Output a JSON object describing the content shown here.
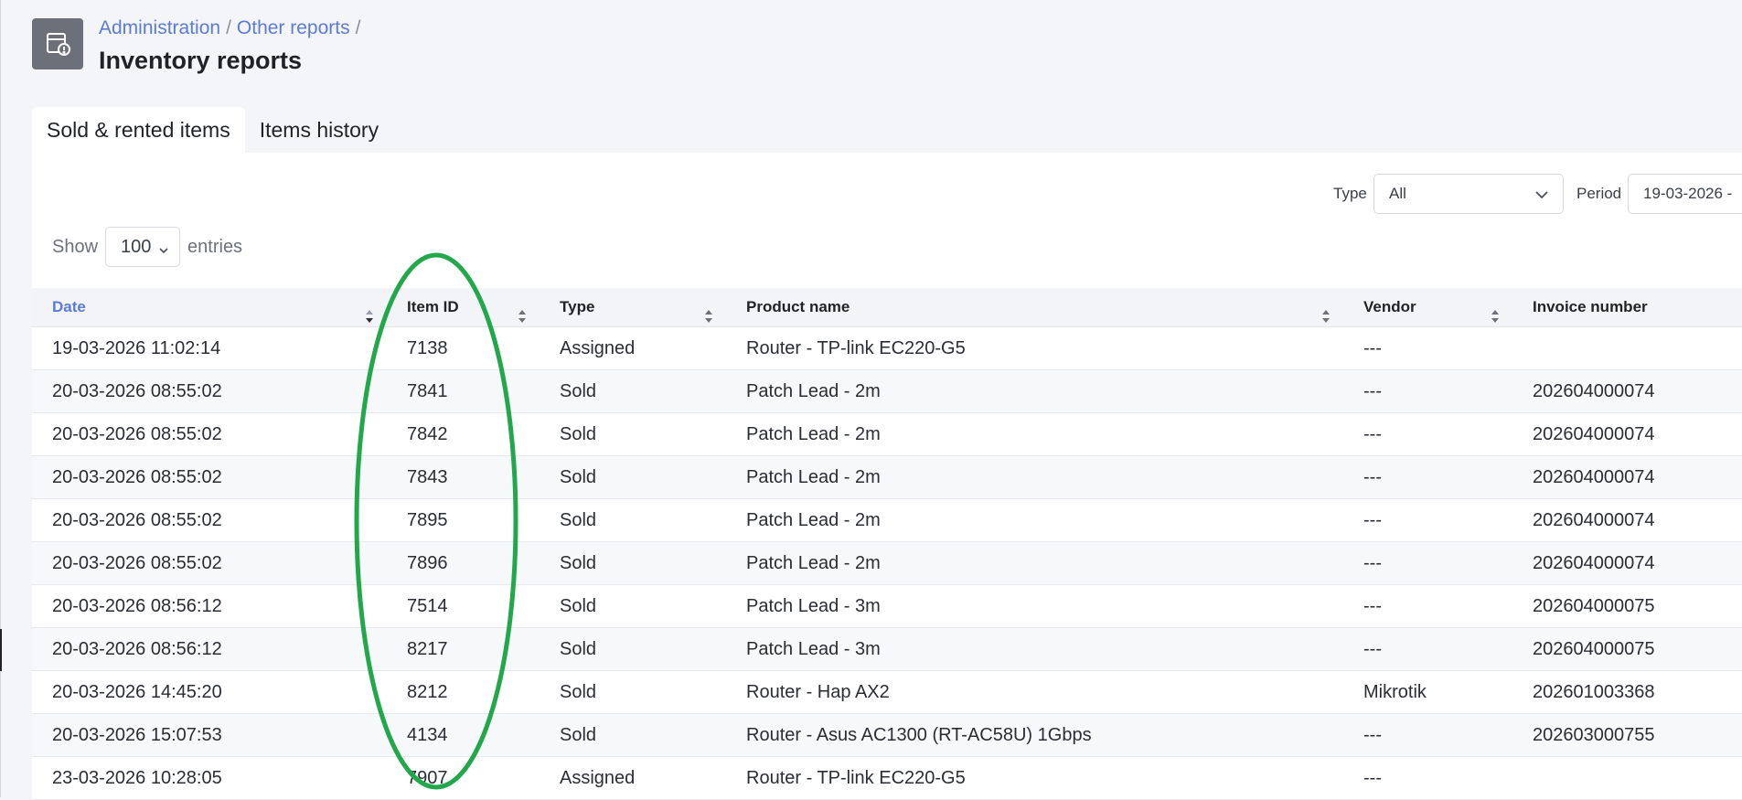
{
  "breadcrumb": {
    "items": [
      "Administration",
      "Other reports"
    ],
    "separator": "/"
  },
  "page_title": "Inventory reports",
  "tabs": [
    {
      "label": "Sold & rented items",
      "active": true
    },
    {
      "label": "Items history",
      "active": false
    }
  ],
  "filters": {
    "type_label": "Type",
    "type_value": "All",
    "period_label": "Period",
    "period_value": "19-03-2026 -"
  },
  "length_menu": {
    "show_label": "Show",
    "value": "100",
    "entries_label": "entries"
  },
  "table": {
    "columns": [
      "Date",
      "Item ID",
      "Type",
      "Product name",
      "Vendor",
      "Invoice number"
    ],
    "rows": [
      [
        "19-03-2026 11:02:14",
        "7138",
        "Assigned",
        "Router - TP-link EC220-G5",
        "---",
        ""
      ],
      [
        "20-03-2026 08:55:02",
        "7841",
        "Sold",
        "Patch Lead - 2m",
        "---",
        "202604000074"
      ],
      [
        "20-03-2026 08:55:02",
        "7842",
        "Sold",
        "Patch Lead - 2m",
        "---",
        "202604000074"
      ],
      [
        "20-03-2026 08:55:02",
        "7843",
        "Sold",
        "Patch Lead - 2m",
        "---",
        "202604000074"
      ],
      [
        "20-03-2026 08:55:02",
        "7895",
        "Sold",
        "Patch Lead - 2m",
        "---",
        "202604000074"
      ],
      [
        "20-03-2026 08:55:02",
        "7896",
        "Sold",
        "Patch Lead - 2m",
        "---",
        "202604000074"
      ],
      [
        "20-03-2026 08:56:12",
        "7514",
        "Sold",
        "Patch Lead - 3m",
        "---",
        "202604000075"
      ],
      [
        "20-03-2026 08:56:12",
        "8217",
        "Sold",
        "Patch Lead - 3m",
        "---",
        "202604000075"
      ],
      [
        "20-03-2026 14:45:20",
        "8212",
        "Sold",
        "Router - Hap AX2",
        "Mikrotik",
        "202601003368"
      ],
      [
        "20-03-2026 15:07:53",
        "4134",
        "Sold",
        "Router - Asus AC1300 (RT-AC58U) 1Gbps",
        "---",
        "202603000755"
      ],
      [
        "23-03-2026 10:28:05",
        "7907",
        "Assigned",
        "Router - TP-link EC220-G5",
        "---",
        ""
      ]
    ]
  },
  "colors": {
    "accent": "#5b7bd5",
    "annotation": "#22a84a",
    "header_icon_bg": "#6c7078"
  },
  "icons": {
    "header": "inventory-report-icon",
    "sort": "sort-arrows-icon",
    "dropdown": "chevron-down-icon"
  }
}
